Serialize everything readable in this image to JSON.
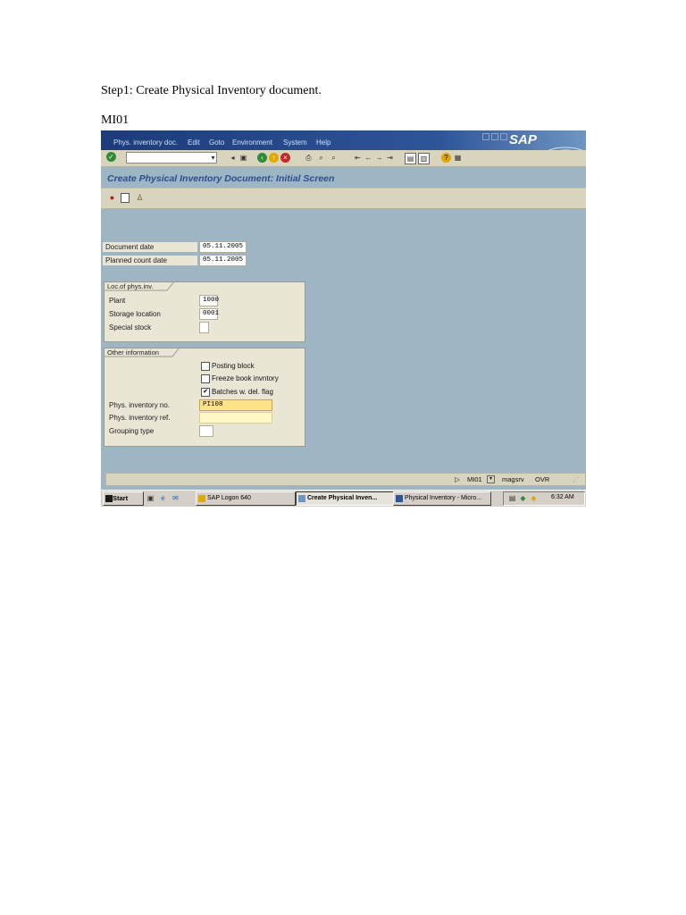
{
  "doc": {
    "step_text": "Step1: Create Physical Inventory document.",
    "tcode_text": "MI01"
  },
  "menu": {
    "items": [
      "Phys. inventory doc.",
      "Edit",
      "Goto",
      "Environment",
      "System",
      "Help"
    ],
    "logo": "SAP"
  },
  "screen": {
    "title": "Create Physical Inventory Document: Initial Screen"
  },
  "form": {
    "document_date_label": "Document date",
    "document_date_value": "05.11.2005",
    "planned_count_date_label": "Planned count date",
    "planned_count_date_value": "05.11.2005",
    "loc_group_title": "Loc.of phys.inv.",
    "plant_label": "Plant",
    "plant_value": "1000",
    "storage_location_label": "Storage location",
    "storage_location_value": "0001",
    "special_stock_label": "Special stock",
    "special_stock_value": "",
    "other_group_title": "Other information",
    "posting_block_label": "Posting block",
    "posting_block_checked": false,
    "freeze_book_label": "Freeze book invntory",
    "freeze_book_checked": false,
    "batches_label": "Batches w. del. flag",
    "batches_checked": true,
    "phys_inv_no_label": "Phys. inventory no.",
    "phys_inv_no_value": "PI108",
    "phys_inv_ref_label": "Phys. inventory ref.",
    "phys_inv_ref_value": "",
    "grouping_type_label": "Grouping type",
    "grouping_type_value": ""
  },
  "status": {
    "tcode": "MI01",
    "server": "magsrv",
    "mode": "OVR"
  },
  "taskbar": {
    "start": "Start",
    "buttons": [
      "SAP Logon 640",
      "Create Physical Inven...",
      "Physical Inventory - Micro..."
    ],
    "clock": "6:32 AM"
  },
  "colors": {
    "screen_bg": "#9eb6c4",
    "title_color": "#2a4d8f",
    "menubar": "#1c3b7a"
  }
}
